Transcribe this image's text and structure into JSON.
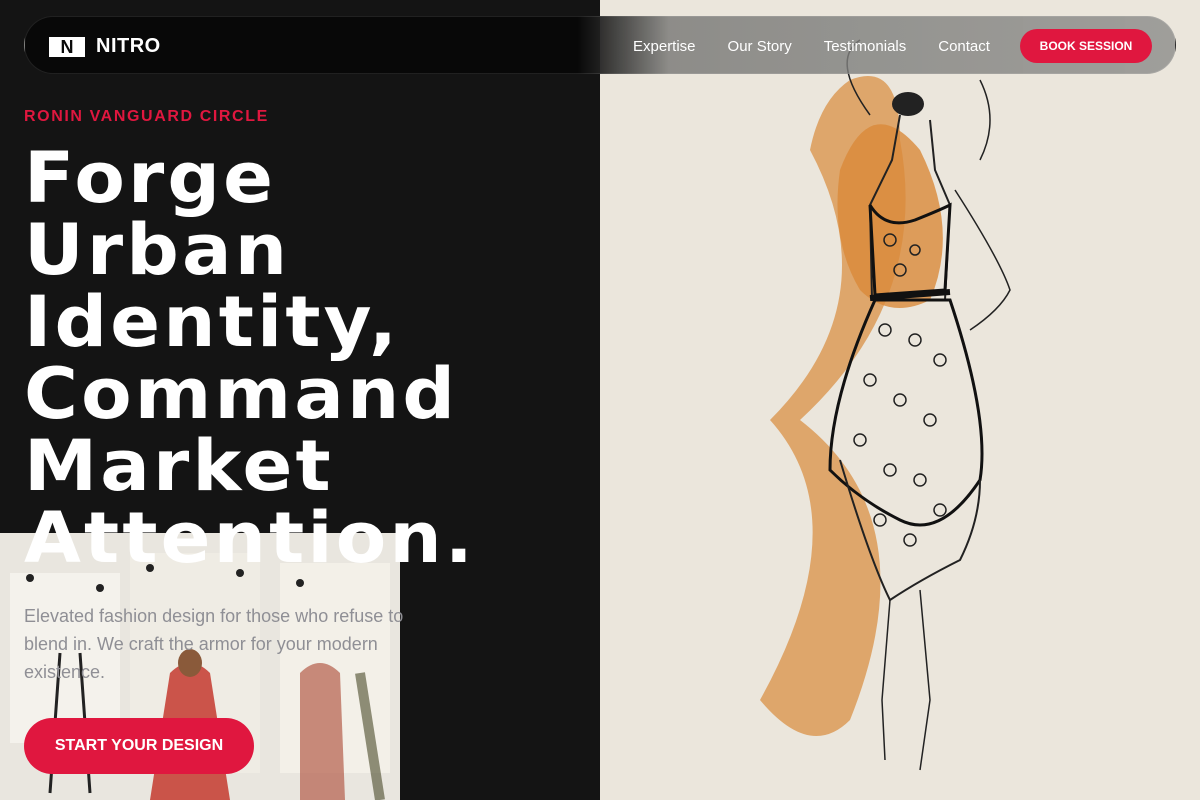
{
  "brand": {
    "logo_mark": "N",
    "name": "NITRO"
  },
  "nav": {
    "links": [
      {
        "label": "Expertise"
      },
      {
        "label": "Our Story"
      },
      {
        "label": "Testimonials"
      },
      {
        "label": "Contact"
      }
    ],
    "cta_label": "BOOK SESSION"
  },
  "hero": {
    "eyebrow": "RONIN VANGUARD CIRCLE",
    "headline_lines": [
      "Forge",
      "Urban",
      "Identity,",
      "Command",
      "Market",
      "Attention."
    ],
    "subtext": "Elevated fashion design for those who refuse to blend in. We craft the armor for your modern existence.",
    "cta_label": "START YOUR DESIGN"
  },
  "colors": {
    "accent": "#e0173f",
    "background": "#141414",
    "paper": "#ebe6dc"
  },
  "images": {
    "hero_image": "fashion-sketch-dress",
    "moodboard_image": "fashion-moodboard-sketches"
  }
}
